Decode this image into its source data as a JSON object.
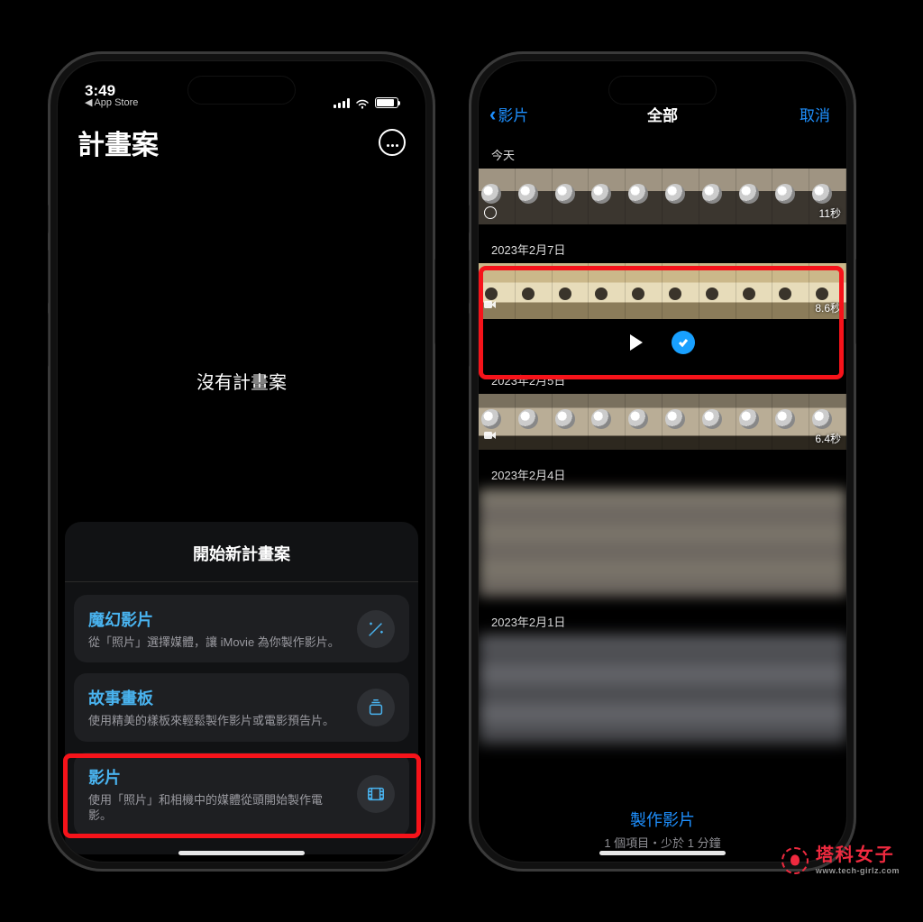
{
  "phone1": {
    "status": {
      "time": "3:49",
      "back_app_label": "App Store"
    },
    "title": "計畫案",
    "empty_state": "沒有計畫案",
    "sheet_title": "開始新計畫案",
    "options": [
      {
        "title": "魔幻影片",
        "desc": "從「照片」選擇媒體，讓 iMovie 為你製作影片。",
        "icon": "wand"
      },
      {
        "title": "故事畫板",
        "desc": "使用精美的樣板來輕鬆製作影片或電影預告片。",
        "icon": "stack"
      },
      {
        "title": "影片",
        "desc": "使用「照片」和相機中的媒體從頭開始製作電影。",
        "icon": "film"
      }
    ]
  },
  "phone2": {
    "nav": {
      "back_label": "影片",
      "title": "全部",
      "cancel": "取消"
    },
    "sections": [
      {
        "label": "今天",
        "duration": "11秒",
        "kind": "coffee"
      },
      {
        "label": "2023年2月7日",
        "duration": "8.6秒",
        "kind": "cat_selected"
      },
      {
        "label": "2023年2月5日",
        "duration": "6.4秒",
        "kind": "cats"
      },
      {
        "label": "2023年2月4日",
        "duration": "",
        "kind": "blur"
      },
      {
        "label": "2023年2月1日",
        "duration": "",
        "kind": "blur"
      }
    ],
    "footer": {
      "action": "製作影片",
      "subtitle": "1 個項目・少於 1 分鐘"
    }
  },
  "watermark": {
    "name": "塔科女子",
    "url": "www.tech-girlz.com"
  }
}
